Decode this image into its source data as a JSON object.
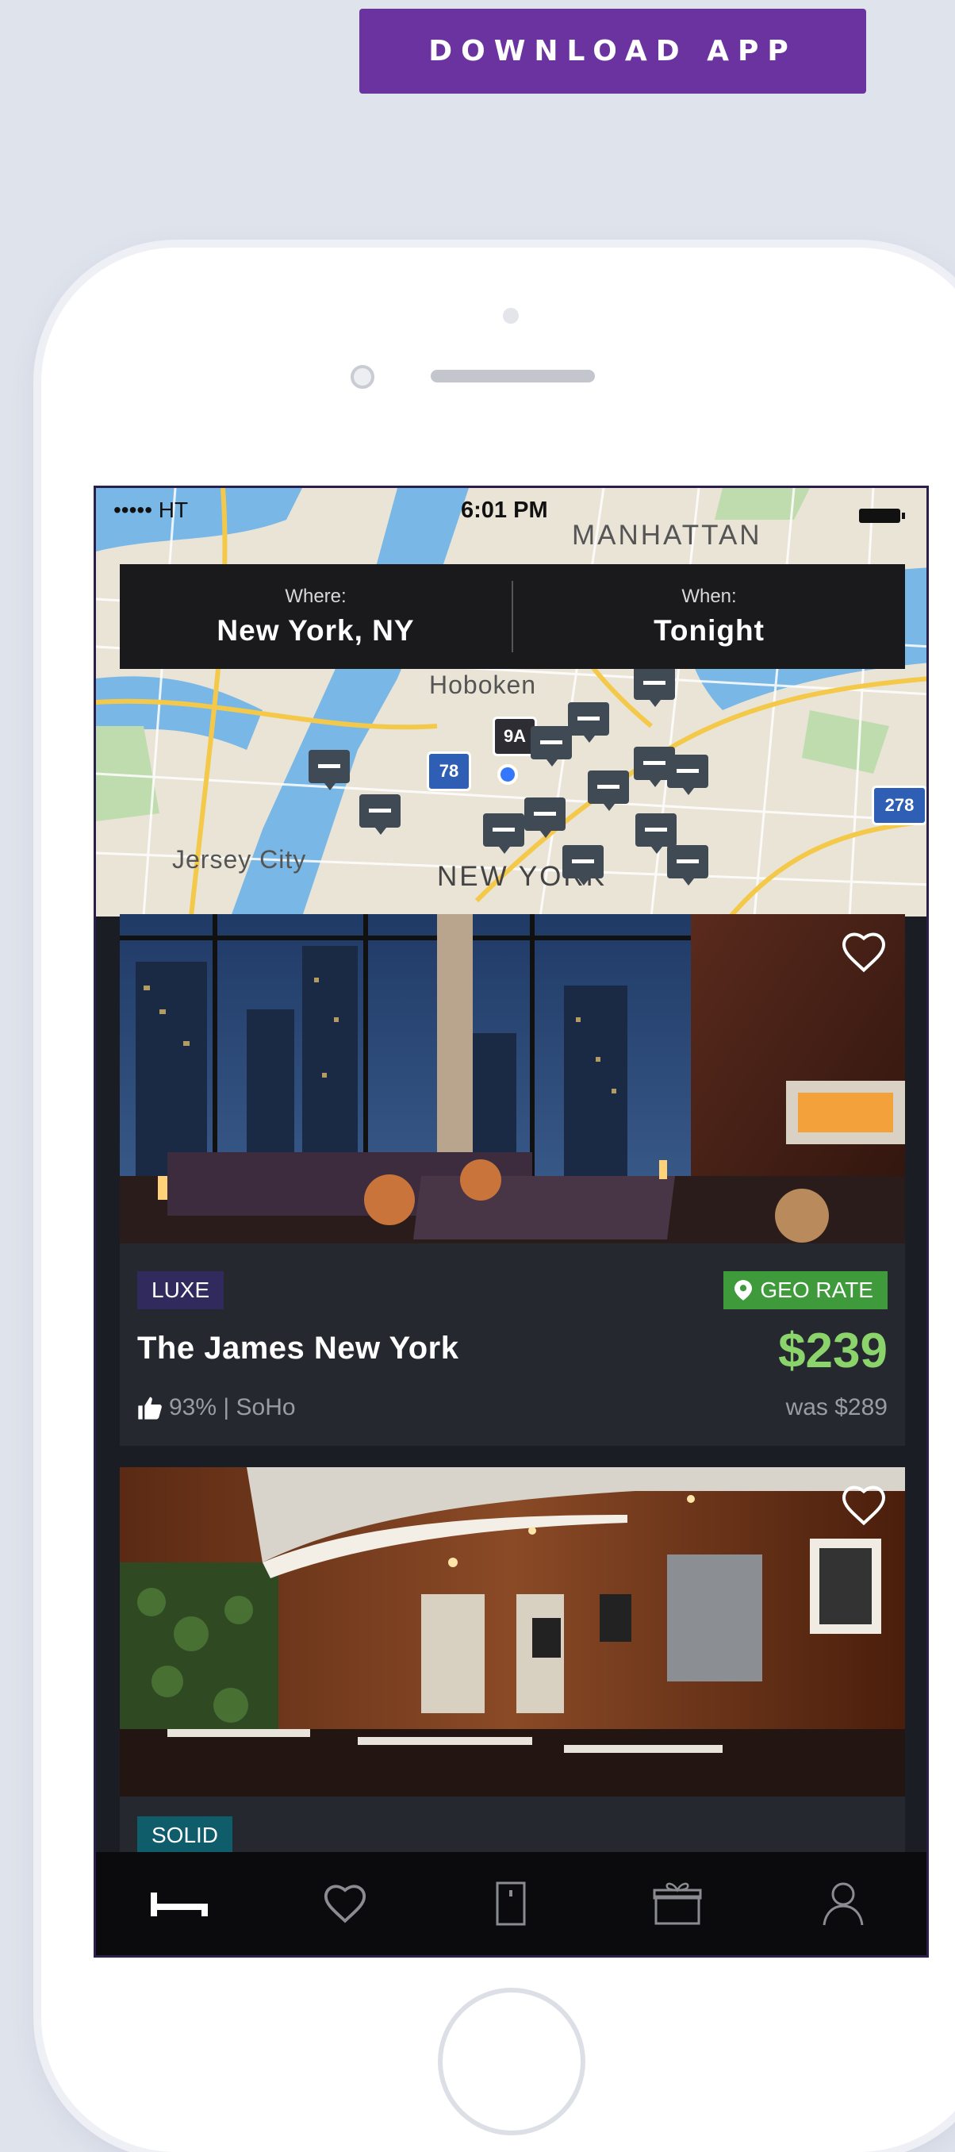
{
  "header": {
    "download_label": "DOWNLOAD APP"
  },
  "status_bar": {
    "carrier": "••••• HT",
    "time": "6:01 PM"
  },
  "search": {
    "where_label": "Where:",
    "where_value": "New York, NY",
    "when_label": "When:",
    "when_value": "Tonight"
  },
  "map": {
    "labels": {
      "manhattan": "MANHATTAN",
      "hoboken": "Hoboken",
      "jersey_city": "Jersey City",
      "new_york": "NEW YORK"
    },
    "shields": {
      "route_9a": "9A",
      "i78": "78",
      "i278": "278"
    }
  },
  "hotels": [
    {
      "tag": "LUXE",
      "geo_rate": "GEO RATE",
      "name": "The James New York",
      "price": "$239",
      "rating": "93% | SoHo",
      "was_price": "was $289"
    },
    {
      "tag": "SOLID"
    }
  ],
  "tabbar": {
    "icons": [
      "bed-icon",
      "heart-icon",
      "door-icon",
      "gift-icon",
      "user-icon"
    ]
  },
  "colors": {
    "accent": "#6a33a0",
    "price_green": "#8ad46b",
    "geo_rate_green": "#3f9a3c",
    "luxe_tag": "#302b5c",
    "solid_tag": "#0f5c6b"
  }
}
